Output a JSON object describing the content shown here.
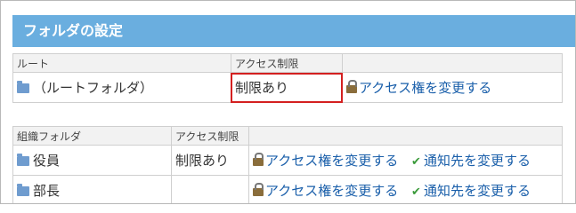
{
  "section": {
    "title": "フォルダの設定"
  },
  "root_table": {
    "headers": [
      "ルート",
      "アクセス制限",
      ""
    ],
    "row": {
      "name": "（ルートフォルダ）",
      "restriction": "制限あり",
      "change_access_link": "アクセス権を変更する"
    }
  },
  "org_table": {
    "headers": [
      "組織フォルダ",
      "アクセス制限",
      ""
    ],
    "rows": [
      {
        "name": "役員",
        "restriction": "制限あり",
        "change_access_link": "アクセス権を変更する",
        "change_notify_link": "通知先を変更する"
      },
      {
        "name": "部長",
        "restriction": "",
        "change_access_link": "アクセス権を変更する",
        "change_notify_link": "通知先を変更する"
      }
    ]
  },
  "icons": {
    "folder": "folder-icon",
    "lock": "lock-icon",
    "check": "check-icon"
  },
  "colors": {
    "header_bg": "#6aaedf",
    "link": "#1a5faa",
    "highlight": "#d42020"
  }
}
